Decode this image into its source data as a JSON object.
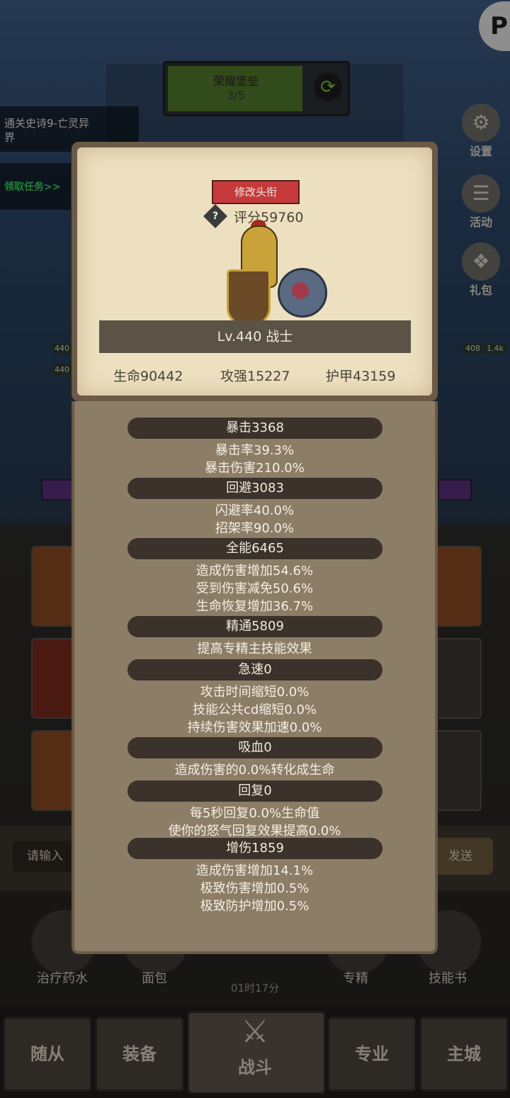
{
  "background": {
    "quest_text": "通关史诗9-亡灵异界",
    "claim_text": "领取任务>>",
    "stage": {
      "name": "荣耀堡垒",
      "progress": "3/5"
    },
    "side_buttons": [
      {
        "label": "设置",
        "icon": "gear-icon"
      },
      {
        "label": "活动",
        "icon": "scroll-icon"
      },
      {
        "label": "礼包",
        "icon": "gift-icon"
      }
    ],
    "level_chips": [
      "440",
      "440",
      "408",
      "1.4k"
    ],
    "chat_placeholder": "请输入",
    "chat_send": "发送",
    "quick_items": [
      "治疗药水",
      "面包",
      "专精",
      "技能书"
    ],
    "timer": "01时17分",
    "nav_tabs": [
      "随从",
      "装备",
      "战斗",
      "专业",
      "主城"
    ]
  },
  "character": {
    "title_button": "修改头衔",
    "score": "评分59760",
    "level_text": "Lv.440 战士",
    "hp": "生命90442",
    "attack": "攻强15227",
    "armor": "护甲43159"
  },
  "stats": [
    {
      "header": "暴击3368",
      "lines": [
        "暴击率39.3%",
        "暴击伤害210.0%"
      ]
    },
    {
      "header": "回避3083",
      "lines": [
        "闪避率40.0%",
        "招架率90.0%"
      ]
    },
    {
      "header": "全能6465",
      "lines": [
        "造成伤害增加54.6%",
        "受到伤害减免50.6%",
        "生命恢复增加36.7%"
      ]
    },
    {
      "header": "精通5809",
      "lines": [
        "提高专精主技能效果"
      ]
    },
    {
      "header": "急速0",
      "lines": [
        "攻击时间缩短0.0%",
        "技能公共cd缩短0.0%",
        "持续伤害效果加速0.0%"
      ]
    },
    {
      "header": "吸血0",
      "lines": [
        "造成伤害的0.0%转化成生命"
      ]
    },
    {
      "header": "回复0",
      "lines": [
        "每5秒回复0.0%生命值",
        "使你的怒气回复效果提高0.0%"
      ]
    },
    {
      "header": "增伤1859",
      "lines": [
        "造成伤害增加14.1%",
        "极致伤害增加0.5%",
        "极致防护增加0.5%"
      ]
    }
  ]
}
